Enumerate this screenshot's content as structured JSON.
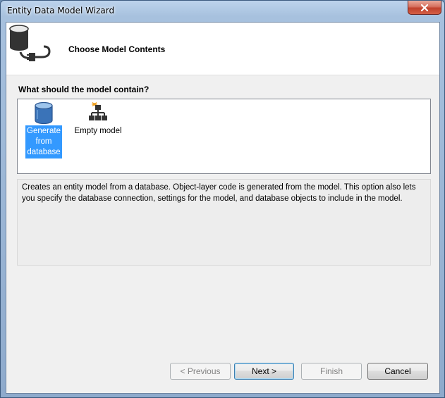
{
  "window": {
    "title": "Entity Data Model Wizard"
  },
  "titlebar": {
    "close_icon": "close-icon"
  },
  "header": {
    "title": "Choose Model Contents",
    "icon": "database-plug-icon"
  },
  "question": {
    "label": "What should the model contain?"
  },
  "model_options": [
    {
      "label": "Generate from database",
      "icon": "database-icon",
      "selected": true
    },
    {
      "label": "Empty model",
      "icon": "hierarchy-icon",
      "selected": false
    }
  ],
  "description": {
    "text": "Creates an entity model from a database. Object-layer code is generated from the model. This option also lets you specify the database connection, settings for the model, and database objects to include in the model."
  },
  "buttons": {
    "previous": "< Previous",
    "next": "Next >",
    "finish": "Finish",
    "cancel": "Cancel"
  },
  "colors": {
    "selection": "#3399ff",
    "titlebar": "#a7c1de",
    "close_button": "#c0412c"
  }
}
